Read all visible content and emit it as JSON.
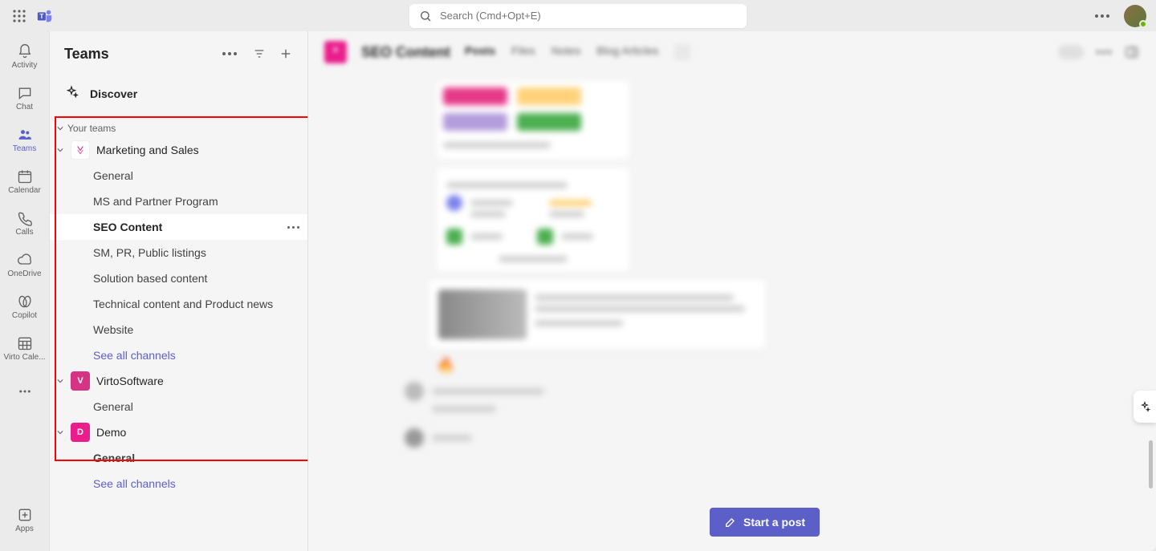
{
  "search": {
    "placeholder": "Search (Cmd+Opt+E)"
  },
  "rail": {
    "items": [
      {
        "key": "activity",
        "label": "Activity"
      },
      {
        "key": "chat",
        "label": "Chat"
      },
      {
        "key": "teams",
        "label": "Teams",
        "active": true
      },
      {
        "key": "calendar",
        "label": "Calendar"
      },
      {
        "key": "calls",
        "label": "Calls"
      },
      {
        "key": "onedrive",
        "label": "OneDrive"
      },
      {
        "key": "copilot",
        "label": "Copilot"
      },
      {
        "key": "virtocale",
        "label": "Virto Cale..."
      }
    ],
    "apps_label": "Apps"
  },
  "midpanel": {
    "title": "Teams",
    "discover_label": "Discover",
    "section_label": "Your teams",
    "teams": [
      {
        "name": "Marketing and Sales",
        "color": "#ffffff",
        "glyph_color": "#d63384",
        "channels": [
          {
            "label": "General"
          },
          {
            "label": "MS and Partner Program"
          },
          {
            "label": "SEO Content",
            "active": true
          },
          {
            "label": "SM, PR, Public listings"
          },
          {
            "label": "Solution based content"
          },
          {
            "label": "Technical content and Product news"
          },
          {
            "label": "Website"
          },
          {
            "label": "See all channels",
            "link": true
          }
        ]
      },
      {
        "name": "VirtoSoftware",
        "color": "#d63384",
        "glyph": "V",
        "channels": [
          {
            "label": "General"
          }
        ]
      },
      {
        "name": "Demo",
        "color": "#e91e8c",
        "glyph": "D",
        "channels": [
          {
            "label": "General",
            "bold": true
          },
          {
            "label": "See all channels",
            "link": true
          }
        ]
      }
    ]
  },
  "content": {
    "channel_title": "SEO Content",
    "tabs": [
      "Posts",
      "Files",
      "Notes",
      "Blog Articles"
    ],
    "start_post_label": "Start a post"
  }
}
